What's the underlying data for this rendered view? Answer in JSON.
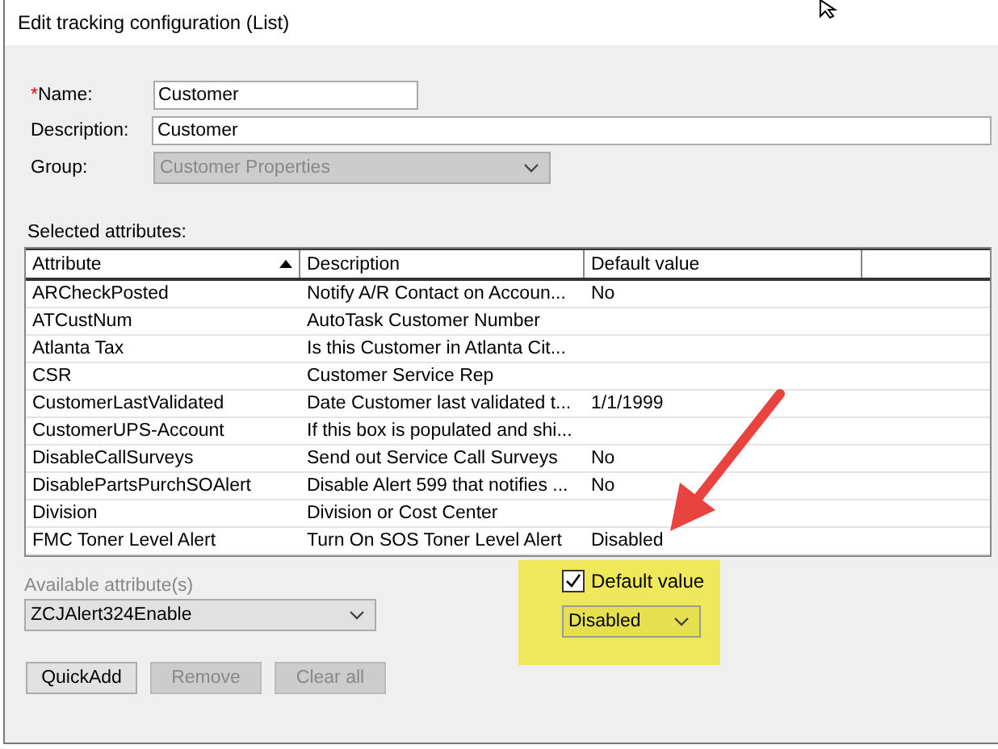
{
  "window": {
    "title": "Edit tracking configuration (List)"
  },
  "form": {
    "name": {
      "required_mark": "*",
      "label": "Name:",
      "value": "Customer"
    },
    "description": {
      "label": "Description:",
      "value": "Customer"
    },
    "group": {
      "label": "Group:",
      "value": "Customer Properties",
      "disabled": true
    }
  },
  "selected_attributes": {
    "label": "Selected attributes:",
    "columns": [
      {
        "label": "Attribute",
        "sorted": true
      },
      {
        "label": "Description",
        "sorted": false
      },
      {
        "label": "Default value",
        "sorted": false
      }
    ],
    "rows": [
      {
        "attribute": "ARCheckPosted",
        "description": "Notify A/R Contact on Accoun...",
        "default": "No"
      },
      {
        "attribute": "ATCustNum",
        "description": "AutoTask Customer Number",
        "default": ""
      },
      {
        "attribute": "Atlanta Tax",
        "description": "Is this Customer in Atlanta Cit...",
        "default": ""
      },
      {
        "attribute": "CSR",
        "description": "Customer Service Rep",
        "default": ""
      },
      {
        "attribute": "CustomerLastValidated",
        "description": "Date Customer last validated t...",
        "default": "1/1/1999"
      },
      {
        "attribute": "CustomerUPS-Account",
        "description": "If this box is populated and shi...",
        "default": ""
      },
      {
        "attribute": "DisableCallSurveys",
        "description": "Send out Service Call Surveys",
        "default": "No"
      },
      {
        "attribute": "DisablePartsPurchSOAlert",
        "description": "Disable Alert 599 that notifies ...",
        "default": "No"
      },
      {
        "attribute": "Division",
        "description": "Division or Cost Center",
        "default": ""
      },
      {
        "attribute": "FMC Toner Level Alert",
        "description": "Turn On SOS Toner Level Alert",
        "default": "Disabled"
      }
    ]
  },
  "available": {
    "label": "Available attribute(s)",
    "value": "ZCJAlert324Enable"
  },
  "default_value": {
    "label": "Default value",
    "checked": true,
    "value": "Disabled"
  },
  "buttons": [
    {
      "label": "QuickAdd",
      "disabled": false
    },
    {
      "label": "Remove",
      "disabled": true
    },
    {
      "label": "Clear all",
      "disabled": true
    }
  ]
}
